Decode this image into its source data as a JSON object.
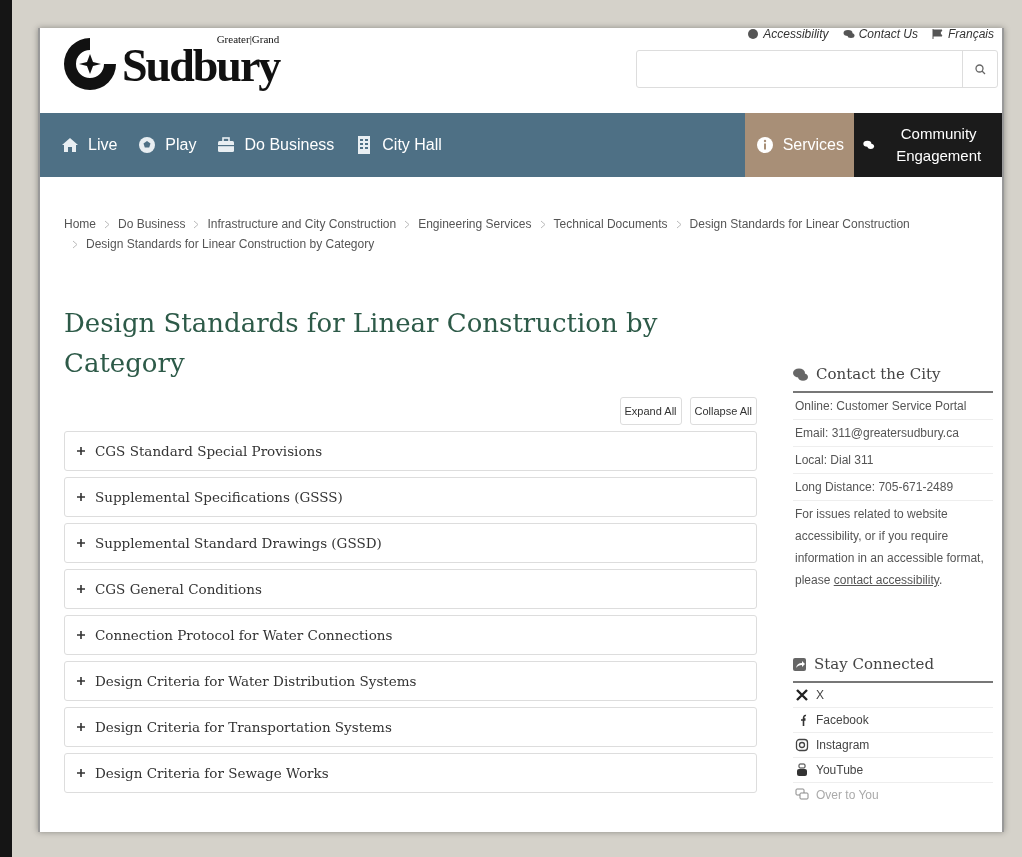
{
  "utility_links": [
    {
      "label": "Accessibility",
      "kind": "accessibility"
    },
    {
      "label": "Contact Us",
      "kind": "contact"
    },
    {
      "label": "Français",
      "kind": "flag"
    }
  ],
  "logo": {
    "small_text": "Greater|Grand",
    "name": "Sudbury"
  },
  "nav": [
    {
      "label": "Live",
      "kind": "home",
      "color": "#4e7085"
    },
    {
      "label": "Play",
      "kind": "ball",
      "color": "#4e7085"
    },
    {
      "label": "Do Business",
      "kind": "briefcase",
      "color": "#4e7085"
    },
    {
      "label": "City Hall",
      "kind": "building",
      "color": "#4e7085"
    },
    {
      "label": "Services",
      "kind": "info",
      "color": "#a88f77"
    },
    {
      "label": "Community Engagement",
      "kind": "chat",
      "color": "#1b1b1b"
    }
  ],
  "breadcrumbs": [
    "Home",
    "Do Business",
    "Infrastructure and City Construction",
    "Engineering Services",
    "Technical Documents",
    "Design Standards for Linear Construction",
    "Design Standards for Linear Construction by Category"
  ],
  "title": "Design Standards for Linear Construction by Category",
  "buttons": [
    "Expand All",
    "Collapse All"
  ],
  "accordion": [
    {
      "label": "CGS Standard Special Provisions",
      "expanded": false
    },
    {
      "label": "Supplemental Specifications (GSSS)",
      "expanded": false
    },
    {
      "label": "Supplemental Standard Drawings (GSSD)",
      "expanded": false
    },
    {
      "label": "CGS General Conditions",
      "expanded": false
    },
    {
      "label": "Connection Protocol for Water Connections",
      "expanded": false
    },
    {
      "label": "Design Criteria for Water Distribution Systems",
      "expanded": false
    },
    {
      "label": "Design Criteria for Transportation Systems",
      "expanded": false
    },
    {
      "label": "Design Criteria for Sewage Works",
      "expanded": false
    }
  ],
  "contact": {
    "heading": "Contact the City",
    "items": [
      "Online: Customer Service Portal",
      "Email: 311@greatersudbury.ca",
      "Local: Dial 311",
      "Long Distance: 705-671-2489"
    ],
    "note": {
      "text": "For issues related to website accessibility, or if you require information in an accessible format, please",
      "link": "contact accessibility",
      "after": "."
    }
  },
  "social": {
    "heading": "Stay Connected",
    "items": [
      {
        "label": "X",
        "kind": "x"
      },
      {
        "label": "Facebook",
        "kind": "facebook"
      },
      {
        "label": "Instagram",
        "kind": "instagram"
      },
      {
        "label": "YouTube",
        "kind": "youtube"
      },
      {
        "label": "Over to You",
        "kind": "chat"
      }
    ]
  }
}
